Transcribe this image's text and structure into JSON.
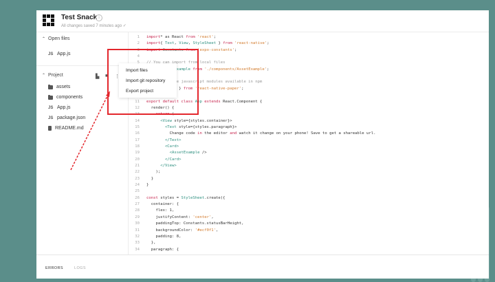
{
  "header": {
    "title": "Test Snack",
    "save_status": "All changes saved 7 minutes ago  ✓"
  },
  "sidebar": {
    "open_files_label": "Open files",
    "open_files": [
      {
        "name": "App.js",
        "icon": "js-icon"
      }
    ],
    "project_label": "Project",
    "project_files": [
      {
        "name": "assets",
        "icon": "folder-icon"
      },
      {
        "name": "components",
        "icon": "folder-icon"
      },
      {
        "name": "App.js",
        "icon": "js-icon"
      },
      {
        "name": "package.json",
        "icon": "js-icon"
      },
      {
        "name": "README.md",
        "icon": "file-icon"
      }
    ]
  },
  "dropdown": {
    "items": [
      "Import files",
      "Import git repository",
      "Export project"
    ]
  },
  "editor": {
    "lines": [
      [
        [
          "kw",
          "import"
        ],
        [
          "",
          "* as React "
        ],
        [
          "kw",
          "from"
        ],
        [
          "str",
          " 'react'"
        ],
        [
          "",
          ";"
        ]
      ],
      [
        [
          "kw",
          "import"
        ],
        [
          "",
          "{ "
        ],
        [
          "ty",
          "Text"
        ],
        [
          "",
          ", "
        ],
        [
          "ty",
          "View"
        ],
        [
          "",
          ", "
        ],
        [
          "ty",
          "StyleSheet"
        ],
        [
          "",
          " } "
        ],
        [
          "kw",
          "from"
        ],
        [
          "str",
          " 'react-native'"
        ],
        [
          "",
          ";"
        ]
      ],
      [
        [
          "kw",
          "import"
        ],
        [
          "ty",
          " Constants"
        ],
        [
          "kw",
          " from"
        ],
        [
          "str",
          " 'expo-constants'"
        ],
        [
          "",
          ";"
        ]
      ],
      [
        [
          "",
          ""
        ]
      ],
      [
        [
          "cm",
          "// You can import from local files"
        ]
      ],
      [
        [
          "kw",
          "import"
        ],
        [
          "ty",
          " AssetExample"
        ],
        [
          "kw",
          " from"
        ],
        [
          "str",
          " './components/AssetExample'"
        ],
        [
          "",
          ";"
        ]
      ],
      [
        [
          "",
          ""
        ]
      ],
      [
        [
          "cm",
          "// or any pure javascript modules available in npm"
        ]
      ],
      [
        [
          "kw",
          "import"
        ],
        [
          "",
          "",
          " { "
        ],
        [
          "ty",
          "Card"
        ],
        [
          "",
          " } "
        ],
        [
          "kw",
          "from"
        ],
        [
          "str",
          " 'react-native-paper'"
        ],
        [
          "",
          ";"
        ]
      ],
      [
        [
          "",
          ""
        ]
      ],
      [
        [
          "kw",
          "export default class"
        ],
        [
          "ty",
          " App"
        ],
        [
          "kw",
          " extends"
        ],
        [
          "",
          " React.Component {"
        ]
      ],
      [
        [
          "",
          "  render() {"
        ]
      ],
      [
        [
          "kw",
          "    return"
        ],
        [
          "",
          " ("
        ]
      ],
      [
        [
          "ty",
          "      <View"
        ],
        [
          "",
          " style={styles.container}>"
        ]
      ],
      [
        [
          "ty",
          "        <Text"
        ],
        [
          "",
          " style={styles.paragraph}>"
        ]
      ],
      [
        [
          "",
          "          Change code "
        ],
        [
          "kw",
          "in"
        ],
        [
          "",
          " the editor "
        ],
        [
          "kw",
          "and"
        ],
        [
          "",
          " watch it change on your phone! Save to get a shareable url."
        ]
      ],
      [
        [
          "ty",
          "        </Text>"
        ]
      ],
      [
        [
          "ty",
          "        <Card>"
        ]
      ],
      [
        [
          "ty",
          "          <AssetExample"
        ],
        [
          "",
          " />"
        ]
      ],
      [
        [
          "ty",
          "        </Card>"
        ]
      ],
      [
        [
          "ty",
          "      </View>"
        ]
      ],
      [
        [
          "",
          "    );"
        ]
      ],
      [
        [
          "",
          "  }"
        ]
      ],
      [
        [
          "",
          "}"
        ]
      ],
      [
        [
          "",
          ""
        ]
      ],
      [
        [
          "kw",
          "const"
        ],
        [
          "",
          " styles = "
        ],
        [
          "ty",
          "StyleSheet"
        ],
        [
          "",
          ".create({"
        ]
      ],
      [
        [
          "",
          "  container: {"
        ]
      ],
      [
        [
          "",
          "    flex: 1,"
        ]
      ],
      [
        [
          "",
          "    justifyContent: "
        ],
        [
          "str",
          "'center'"
        ],
        [
          "",
          ","
        ]
      ],
      [
        [
          "",
          "    paddingTop: Constants.statusBarHeight,"
        ]
      ],
      [
        [
          "",
          "    backgroundColor: "
        ],
        [
          "str",
          "'#ecf0f1'"
        ],
        [
          "",
          ","
        ]
      ],
      [
        [
          "",
          "    padding: 8,"
        ]
      ],
      [
        [
          "",
          "  },"
        ]
      ],
      [
        [
          "",
          "  paragraph: {"
        ]
      ]
    ]
  },
  "bottom_tabs": [
    "ERRORS",
    "LOGS"
  ],
  "colors": {
    "background": "#5b8e8a",
    "highlight_border": "#e3262c",
    "keyword": "#c7254e",
    "string": "#d27a2c",
    "type": "#2d8f7f"
  }
}
